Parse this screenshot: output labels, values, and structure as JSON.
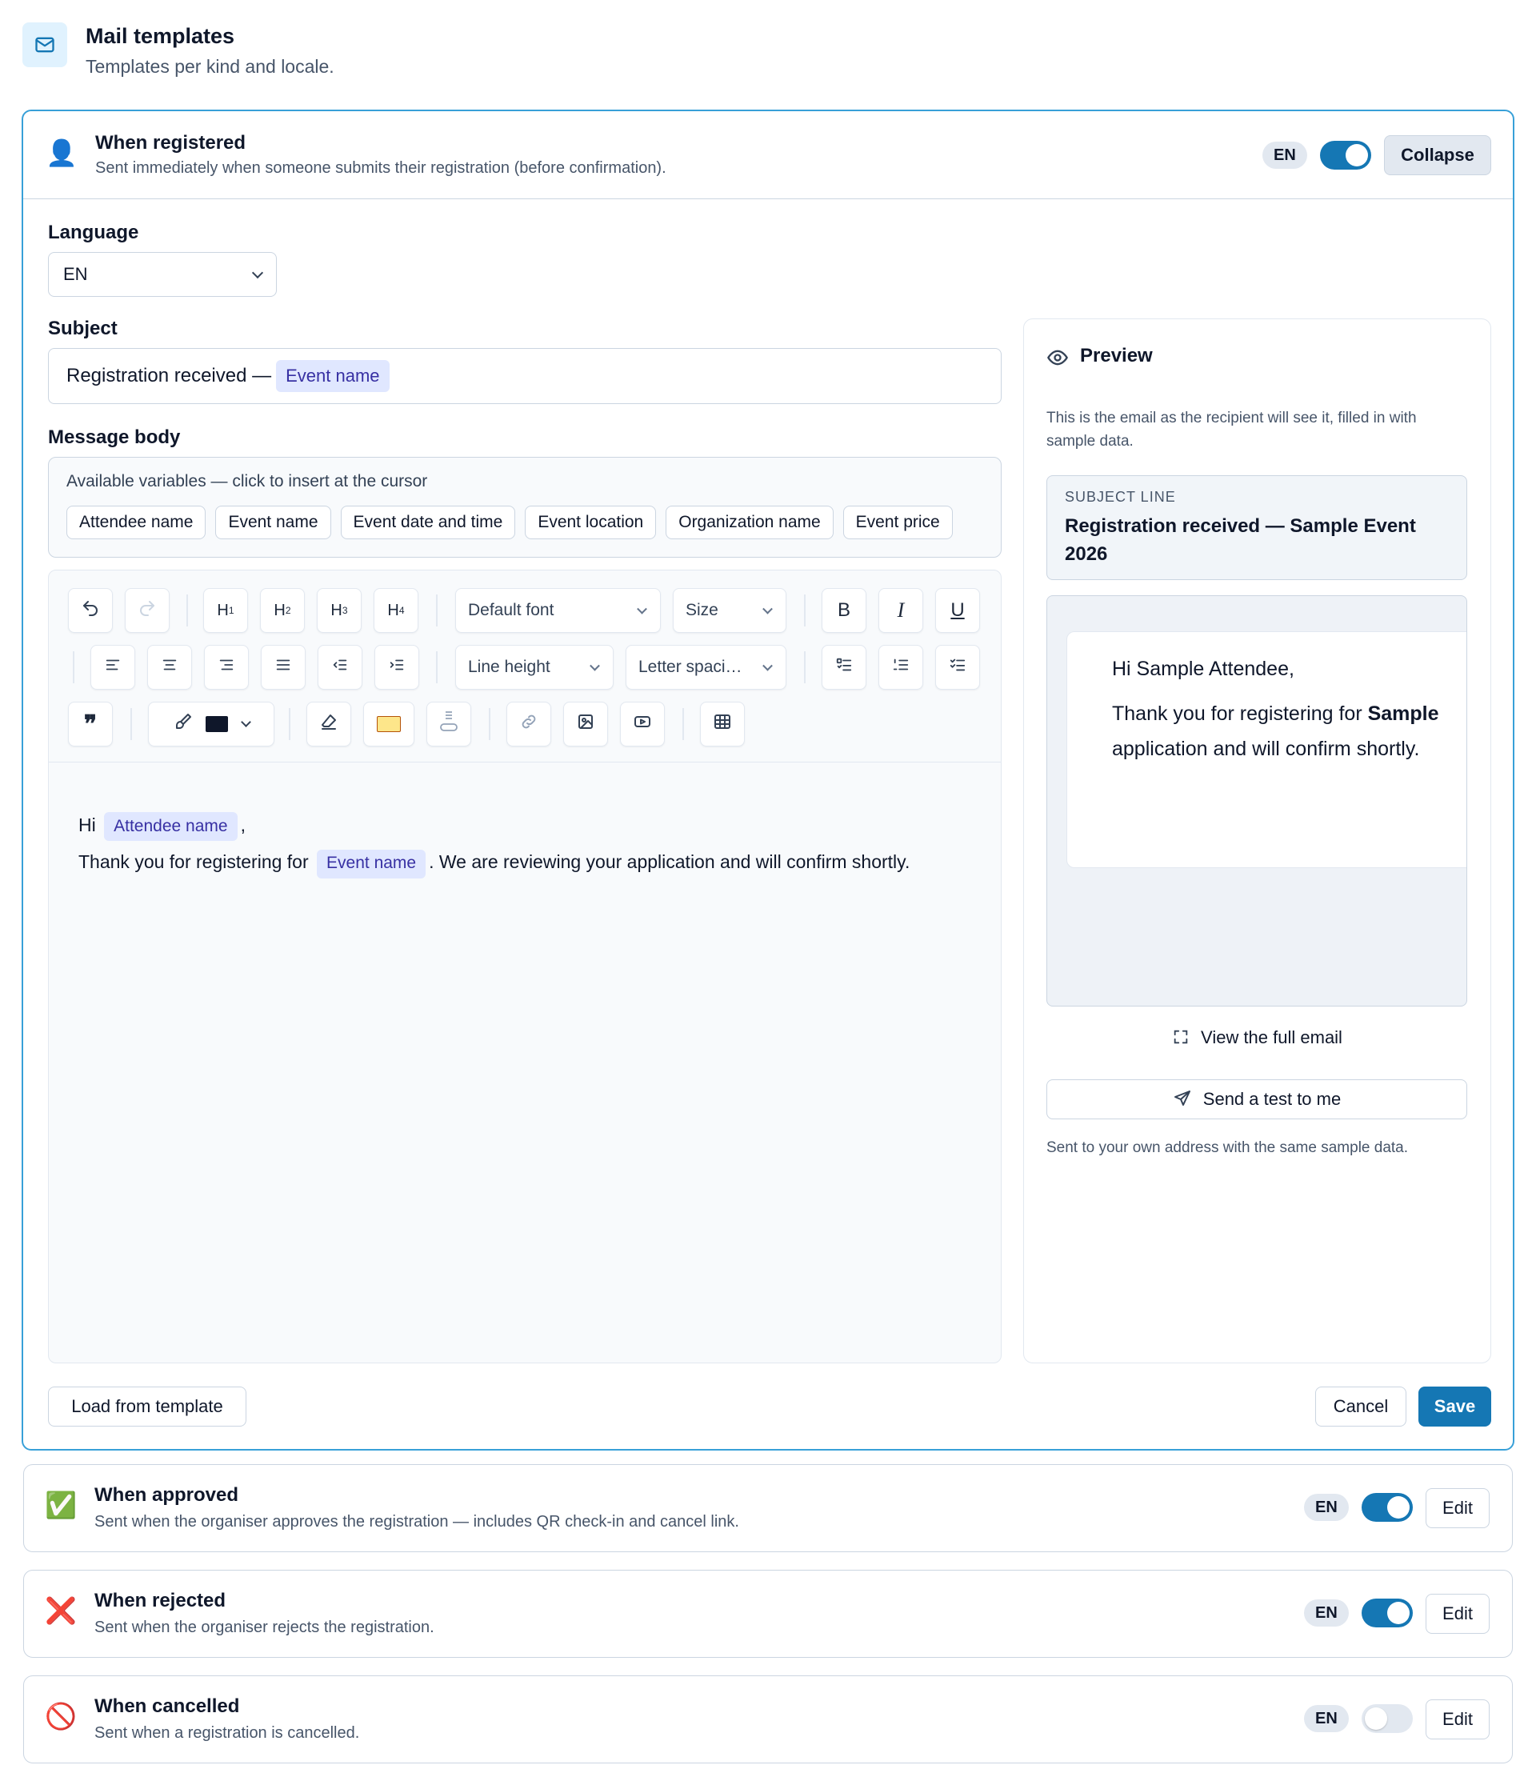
{
  "page": {
    "title": "Mail templates",
    "subtitle": "Templates per kind and locale."
  },
  "expanded": {
    "title": "When registered",
    "description": "Sent immediately when someone submits their registration (before confirmation).",
    "locale_badge": "EN",
    "enabled": true,
    "collapse_label": "Collapse",
    "language_label": "Language",
    "language_value": "EN",
    "subject_label": "Subject",
    "subject_text": "Registration received —",
    "subject_var": "Event name",
    "body_label": "Message body",
    "variables_hint": "Available variables — click to insert at the cursor",
    "variables": [
      "Attendee name",
      "Event name",
      "Event date and time",
      "Event location",
      "Organization name",
      "Event price"
    ],
    "toolbar": {
      "h1": "H",
      "h1_sub": "1",
      "h2": "H",
      "h2_sub": "2",
      "h3": "H",
      "h3_sub": "3",
      "h4": "H",
      "h4_sub": "4",
      "font": "Default font",
      "size": "Size",
      "line_height": "Line height",
      "letter_spacing": "Letter spaci…",
      "bold": "B",
      "italic": "I",
      "underline": "U",
      "text_color": "#0f172a",
      "highlight_color": "#fde68a"
    },
    "body": {
      "greeting_prefix": "Hi",
      "greeting_var": "Attendee name",
      "greeting_suffix": ",",
      "line_prefix": "Thank you for registering for",
      "line_var": "Event name",
      "line_suffix": ". We are reviewing your application and will confirm shortly."
    },
    "load_label": "Load from template",
    "cancel_label": "Cancel",
    "save_label": "Save"
  },
  "preview": {
    "title": "Preview",
    "description": "This is the email as the recipient will see it, filled in with sample data.",
    "subject_label": "SUBJECT LINE",
    "subject_value": "Registration received — Sample Event 2026",
    "email_greeting": "Hi Sample Attendee,",
    "email_line_prefix": "Thank you for registering for ",
    "email_line_bold": "Sample",
    "email_line2": "application and will confirm shortly.",
    "view_full": "View the full email",
    "send_test": "Send a test to me",
    "footer": "Sent to your own address with the same sample data."
  },
  "templates": [
    {
      "icon": "✅",
      "title": "When approved",
      "description": "Sent when the organiser approves the registration — includes QR check-in and cancel link.",
      "locale": "EN",
      "enabled": true,
      "edit_label": "Edit"
    },
    {
      "icon": "❌",
      "title": "When rejected",
      "description": "Sent when the organiser rejects the registration.",
      "locale": "EN",
      "enabled": true,
      "edit_label": "Edit"
    },
    {
      "icon": "🚫",
      "title": "When cancelled",
      "description": "Sent when a registration is cancelled.",
      "locale": "EN",
      "enabled": false,
      "edit_label": "Edit"
    }
  ]
}
